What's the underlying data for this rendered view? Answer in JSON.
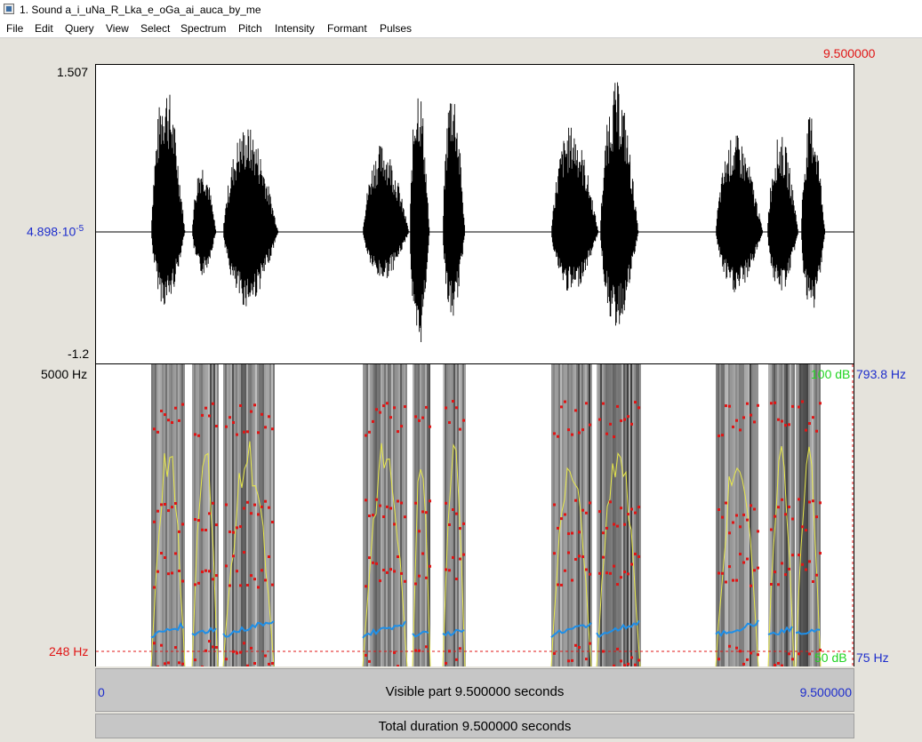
{
  "window": {
    "title": "1. Sound a_i_uNa_R_Lka_e_oGa_ai_auca_by_me"
  },
  "menu": [
    "File",
    "Edit",
    "Query",
    "View",
    "Select",
    "Spectrum",
    "Pitch",
    "Intensity",
    "Formant",
    "Pulses"
  ],
  "cursor": {
    "time_label": "9.500000"
  },
  "waveform": {
    "max_label": "1.507",
    "center_label": "4.898·10",
    "center_exponent": "-5",
    "min_label": "-1.2"
  },
  "spectrogram": {
    "top_freq_label": "5000 Hz",
    "bottom_freq_label": "248 Hz",
    "intensity_top_label": "100 dB",
    "intensity_bottom_label": "50 dB",
    "pitch_top_label": "793.8 Hz",
    "pitch_bottom_label": "75 Hz"
  },
  "timebar": {
    "start_label": "0",
    "end_label": "9.500000",
    "visible_text": "Visible part 9.500000 seconds",
    "total_text": "Total duration 9.500000 seconds"
  },
  "colors": {
    "waveform": "#000000",
    "formant": "#e01515",
    "pitch": "#1e8fe8",
    "intensity": "#e8e84a",
    "time_label": "#1c2ccc",
    "cursor_label": "#e01515"
  }
}
